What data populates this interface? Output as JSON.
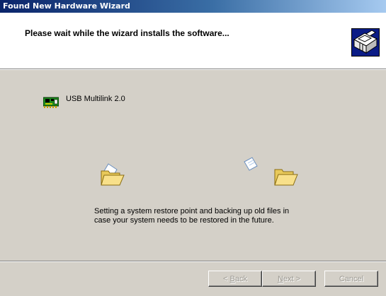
{
  "window": {
    "title": "Found New Hardware Wizard"
  },
  "header": {
    "title": "Please wait while the wizard installs the software...",
    "icon": "hardware-wizard-icon"
  },
  "device": {
    "name": "USB Multilink 2.0",
    "icon": "circuit-board-icon"
  },
  "animation": {
    "source_icon": "folder-icon",
    "moving_icon": "document-icon",
    "target_icon": "folder-icon"
  },
  "status": {
    "line1": "Setting a system restore point and backing up old files in",
    "line2": "case your system needs to be restored in the future."
  },
  "buttons": {
    "back_prefix": "< ",
    "back_mnemonic": "B",
    "back_rest": "ack",
    "next_mnemonic": "N",
    "next_rest": "ext >",
    "cancel": "Cancel"
  },
  "colors": {
    "titlebar_start": "#0a246a",
    "titlebar_end": "#a6caf0",
    "dialog_face": "#d4d0c8",
    "disabled_text": "#9d9a93"
  }
}
